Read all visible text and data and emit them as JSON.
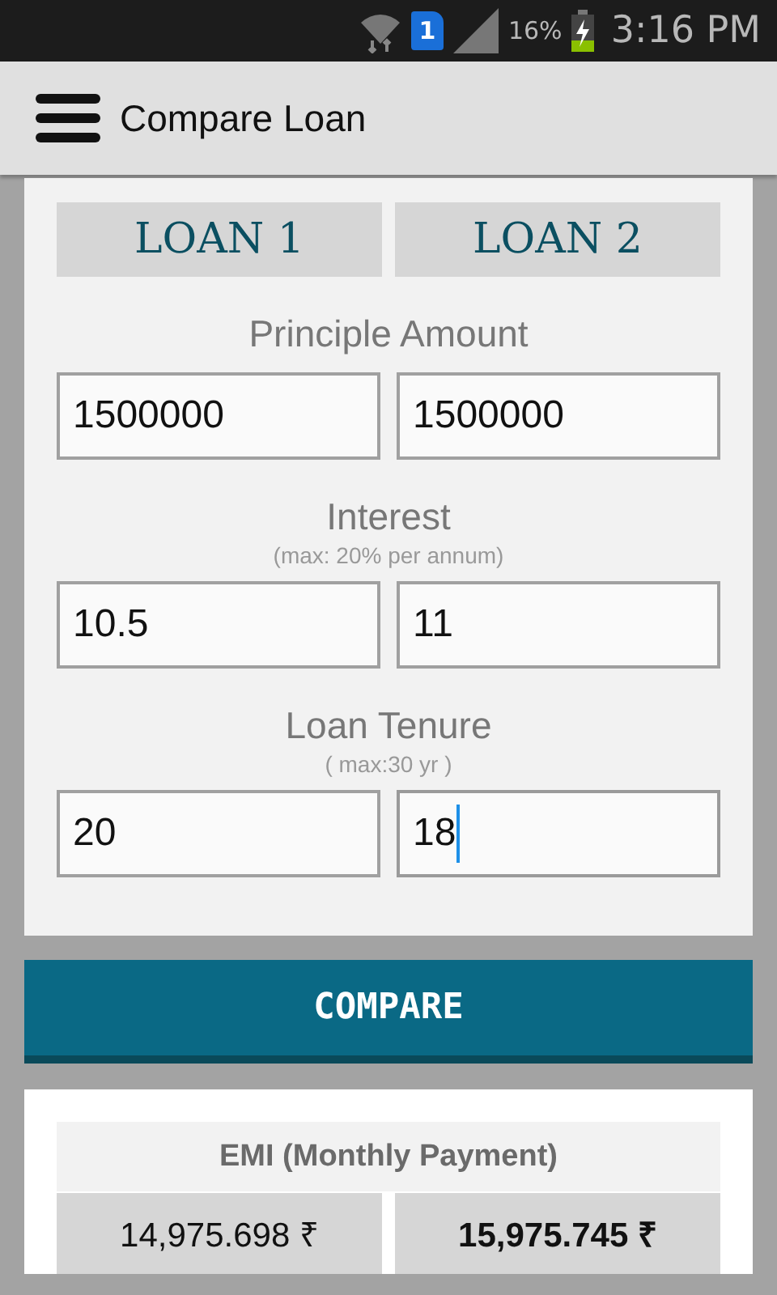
{
  "status_bar": {
    "sim_badge": "1",
    "battery_percent": "16%",
    "battery": {
      "charging": true
    },
    "time": "3:16 PM"
  },
  "app_bar": {
    "title": "Compare Loan"
  },
  "tabs": [
    {
      "label": "LOAN 1",
      "selected": false
    },
    {
      "label": "LOAN 2",
      "selected": false
    }
  ],
  "fields": [
    {
      "label": "Principle Amount",
      "values": [
        {
          "value": "1500000",
          "focused": false
        },
        {
          "value": "1500000",
          "focused": false
        }
      ]
    },
    {
      "label": "Interest",
      "hint": "(max: 20% per annum)",
      "values": [
        {
          "value": "10.5",
          "focused": false
        },
        {
          "value": "11",
          "focused": false
        }
      ]
    },
    {
      "label": "Loan Tenure",
      "hint": "( max:30 yr )",
      "values": [
        {
          "value": "20",
          "focused": false
        },
        {
          "value": "18",
          "focused": true
        }
      ]
    }
  ],
  "compare_button": "COMPARE",
  "results": [
    {
      "title": "EMI (Monthly Payment)",
      "values": [
        {
          "text": "14,975.698 ₹",
          "emphasized": false
        },
        {
          "text": "15,975.745 ₹",
          "emphasized": true
        }
      ]
    }
  ]
}
